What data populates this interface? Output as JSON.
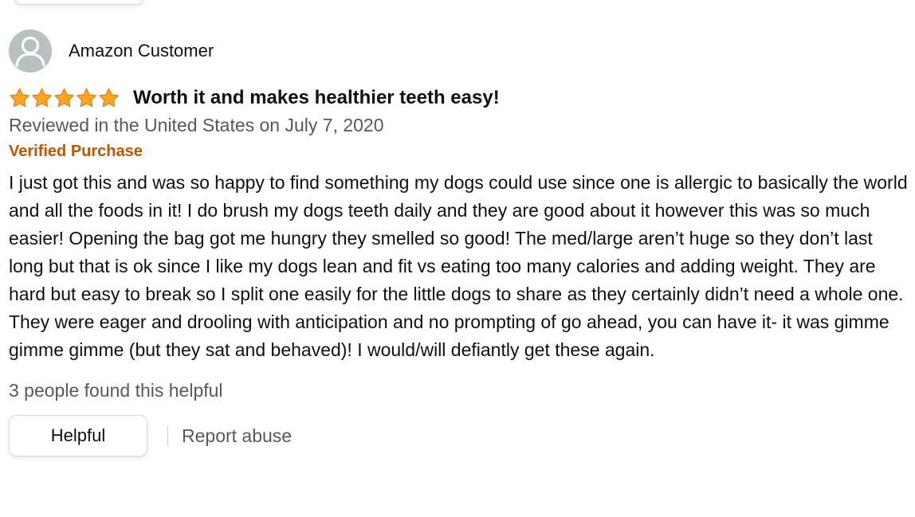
{
  "review": {
    "profile_name": "Amazon Customer",
    "rating": 5,
    "rating_max": 5,
    "star_color": "#ffa41c",
    "title": "Worth it and makes healthier teeth easy!",
    "date_text": "Reviewed in the United States on July 7, 2020",
    "verified_label": "Verified Purchase",
    "verified_color": "#c45500",
    "body": "I just got this and was so happy to find something my dogs could use since one is allergic to basically the world and all the foods in it! I do brush my dogs teeth daily and they are good about it however this was so much easier! Opening the bag got me hungry they smelled so good! The med/large aren’t huge so they don’t last long but that is ok since I like my dogs lean and fit vs eating too many calories and adding weight. They are hard but easy to break so I split one easily for the little dogs to share as they certainly didn’t need a whole one. They were eager and drooling with anticipation and no prompting of go ahead, you can have it- it was gimme gimme gimme (but they sat and behaved)! I would/will defiantly get these again.",
    "helpful_count_text": "3 people found this helpful"
  },
  "actions": {
    "helpful_label": "Helpful",
    "report_label": "Report abuse"
  },
  "icons": {
    "avatar": "default-profile-avatar-icon",
    "star": "star-icon"
  }
}
